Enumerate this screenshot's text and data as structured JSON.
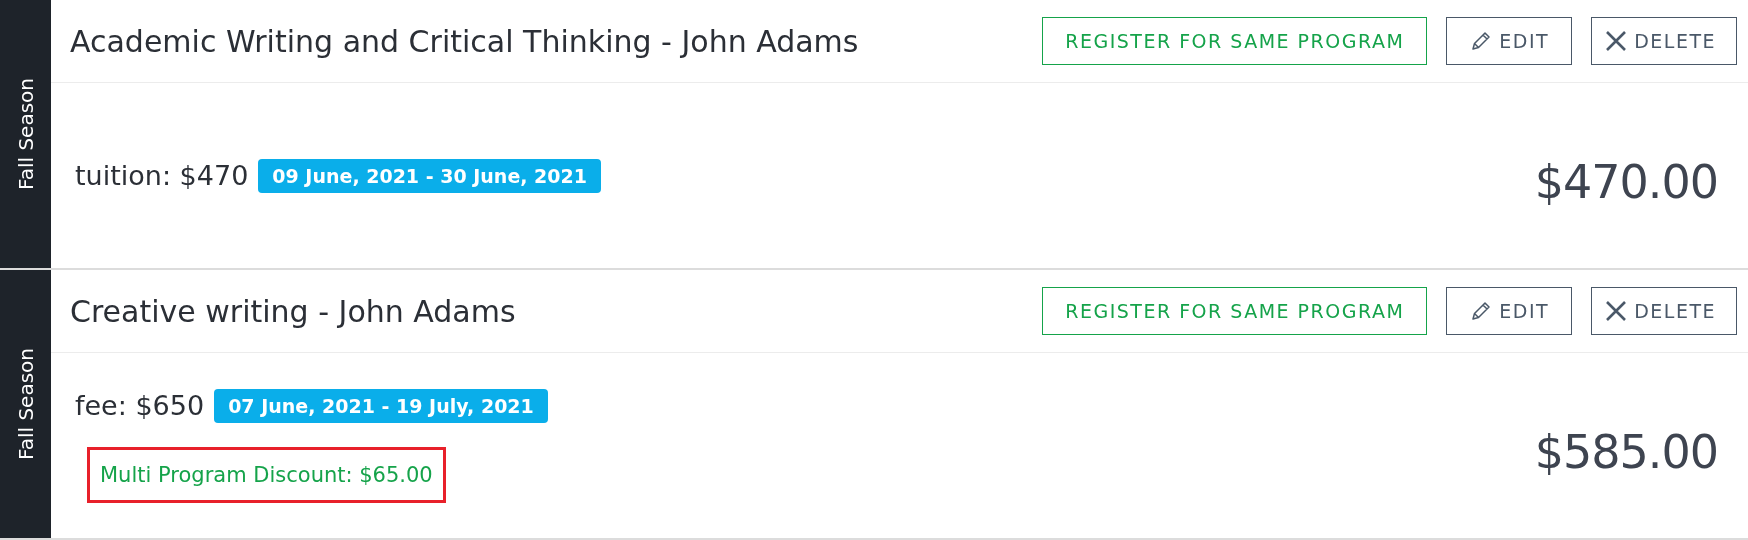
{
  "programs": [
    {
      "season": "Fall Season",
      "title": "Academic Writing and Critical Thinking - John Adams",
      "buttons": [
        {
          "kind": "register",
          "label": "REGISTER FOR SAME PROGRAM"
        },
        {
          "kind": "edit",
          "label": "EDIT"
        },
        {
          "kind": "delete",
          "label": "DELETE"
        }
      ],
      "fee": "tuition: $470",
      "dates": "09 June, 2021 - 30 June, 2021",
      "total": "$470.00"
    },
    {
      "season": "Fall Season",
      "title": "Creative writing - John Adams",
      "buttons": [
        {
          "kind": "register",
          "label": "REGISTER FOR SAME PROGRAM"
        },
        {
          "kind": "edit",
          "label": "EDIT"
        },
        {
          "kind": "delete",
          "label": "DELETE"
        }
      ],
      "fee": "fee: $650",
      "dates": "07 June, 2021 - 19 July, 2021",
      "discount": {
        "text": "Multi Program Discount: $65.00",
        "highlighted": true
      },
      "total": "$585.00"
    }
  ]
}
